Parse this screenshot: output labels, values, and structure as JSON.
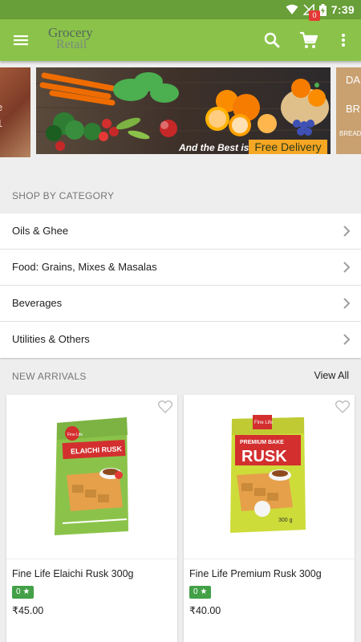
{
  "statusbar": {
    "time": "7:39",
    "icons": [
      "wifi-icon",
      "signal-off-icon",
      "battery-charging-icon"
    ]
  },
  "appbar": {
    "logo_line1": "Grocery",
    "logo_line2": "Retail",
    "cart_count": "0",
    "icons": [
      "menu-icon",
      "search-icon",
      "cart-icon",
      "more-vert-icon"
    ]
  },
  "banner": {
    "tagline": "And the Best is",
    "cta": "Free Delivery",
    "left_side_text": [
      "e",
      "1"
    ],
    "right_side_text": [
      "DA",
      "BR",
      "BREAD"
    ]
  },
  "categories": {
    "title": "SHOP BY CATEGORY",
    "items": [
      {
        "label": "Oils & Ghee"
      },
      {
        "label": "Food: Grains, Mixes & Masalas"
      },
      {
        "label": "Beverages"
      },
      {
        "label": "Utilities & Others"
      }
    ]
  },
  "new_arrivals": {
    "title": "NEW ARRIVALS",
    "view_all": "View All",
    "products": [
      {
        "name": "Fine Life Elaichi Rusk 300g",
        "rating": "0 ★",
        "price": "₹45.00",
        "pack_brand": "Fine Life",
        "pack_label": "ELAICHI RUSK"
      },
      {
        "name": "Fine Life Premium Rusk 300g",
        "rating": "0 ★",
        "price": "₹40.00",
        "pack_brand": "Fine Life",
        "pack_label": "PREMIUM BAKE",
        "pack_label2": "RUSK",
        "pack_weight": "300 g"
      }
    ]
  },
  "colors": {
    "primary": "#8bc34a",
    "primary_dark": "#689f38",
    "rating_green": "#43a047",
    "badge_red": "#e53935"
  }
}
